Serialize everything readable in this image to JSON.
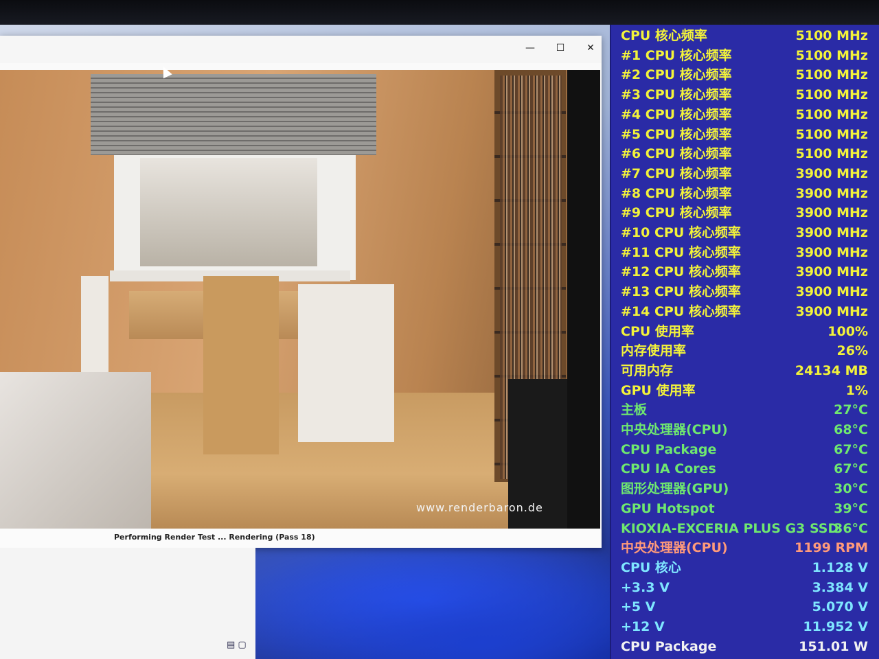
{
  "window": {
    "minimize": "—",
    "maximize": "☐",
    "close": "✕",
    "status": "Performing Render Test ... Rendering (Pass 18)",
    "watermark": "www.renderbaron.de"
  },
  "colors": {
    "yellow": "#f3f33a",
    "green": "#6fe86f",
    "salmon": "#ff9a7a",
    "cyan": "#7fe6ff",
    "white": "#f2f2f2",
    "osd_background": "#2a2ba6"
  },
  "monitor": [
    {
      "label": "CPU 核心频率",
      "value": "5100 MHz",
      "color": "yellow"
    },
    {
      "label": "#1 CPU 核心频率",
      "value": "5100 MHz",
      "color": "yellow"
    },
    {
      "label": "#2 CPU 核心频率",
      "value": "5100 MHz",
      "color": "yellow"
    },
    {
      "label": "#3 CPU 核心频率",
      "value": "5100 MHz",
      "color": "yellow"
    },
    {
      "label": "#4 CPU 核心频率",
      "value": "5100 MHz",
      "color": "yellow"
    },
    {
      "label": "#5 CPU 核心频率",
      "value": "5100 MHz",
      "color": "yellow"
    },
    {
      "label": "#6 CPU 核心频率",
      "value": "5100 MHz",
      "color": "yellow"
    },
    {
      "label": "#7 CPU 核心频率",
      "value": "3900 MHz",
      "color": "yellow"
    },
    {
      "label": "#8 CPU 核心频率",
      "value": "3900 MHz",
      "color": "yellow"
    },
    {
      "label": "#9 CPU 核心频率",
      "value": "3900 MHz",
      "color": "yellow"
    },
    {
      "label": "#10 CPU 核心频率",
      "value": "3900 MHz",
      "color": "yellow"
    },
    {
      "label": "#11 CPU 核心频率",
      "value": "3900 MHz",
      "color": "yellow"
    },
    {
      "label": "#12 CPU 核心频率",
      "value": "3900 MHz",
      "color": "yellow"
    },
    {
      "label": "#13 CPU 核心频率",
      "value": "3900 MHz",
      "color": "yellow"
    },
    {
      "label": "#14 CPU 核心频率",
      "value": "3900 MHz",
      "color": "yellow"
    },
    {
      "label": "CPU 使用率",
      "value": "100%",
      "color": "yellow"
    },
    {
      "label": "内存使用率",
      "value": "26%",
      "color": "yellow"
    },
    {
      "label": "可用内存",
      "value": "24134 MB",
      "color": "yellow"
    },
    {
      "label": "GPU 使用率",
      "value": "1%",
      "color": "yellow"
    },
    {
      "label": "主板",
      "value": "27°C",
      "color": "green"
    },
    {
      "label": "中央处理器(CPU)",
      "value": "68°C",
      "color": "green"
    },
    {
      "label": "CPU Package",
      "value": "67°C",
      "color": "green"
    },
    {
      "label": "CPU IA Cores",
      "value": "67°C",
      "color": "green"
    },
    {
      "label": "图形处理器(GPU)",
      "value": "30°C",
      "color": "green"
    },
    {
      "label": "GPU Hotspot",
      "value": "39°C",
      "color": "green"
    },
    {
      "label": "KIOXIA-EXCERIA PLUS G3 SSD",
      "value": "36°C",
      "color": "green"
    },
    {
      "label": "中央处理器(CPU)",
      "value": "1199 RPM",
      "color": "salmon"
    },
    {
      "label": "CPU 核心",
      "value": "1.128 V",
      "color": "cyan"
    },
    {
      "label": "+3.3 V",
      "value": "3.384 V",
      "color": "cyan"
    },
    {
      "label": "+5 V",
      "value": "5.070 V",
      "color": "cyan"
    },
    {
      "label": "+12 V",
      "value": "11.952 V",
      "color": "cyan"
    },
    {
      "label": "CPU Package",
      "value": "151.01 W",
      "color": "white"
    }
  ]
}
